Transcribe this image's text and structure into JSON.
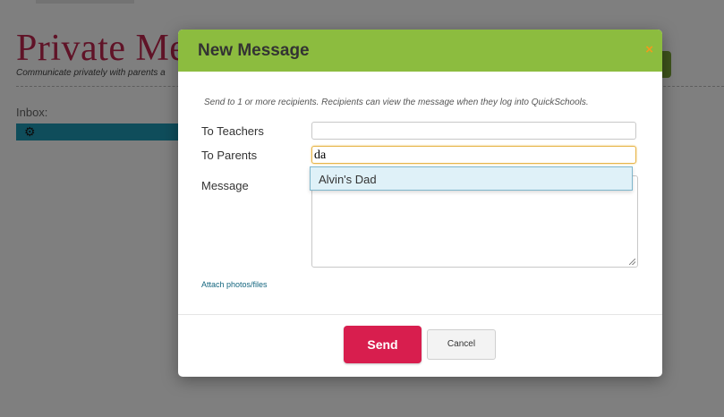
{
  "background": {
    "page_title": "Private Me",
    "subtitle": "Communicate privately with parents a",
    "inbox_label": "Inbox:",
    "inbox_icon": "gear-icon"
  },
  "modal": {
    "title": "New Message",
    "close_icon": "close-icon",
    "close_glyph": "×",
    "intro": "Send to 1 or more recipients. Recipients can view the message when they log into QuickSchools.",
    "fields": {
      "teachers_label": "To Teachers",
      "teachers_value": "",
      "parents_label": "To Parents",
      "parents_value": "da",
      "message_label": "Message",
      "message_value": ""
    },
    "suggestion": "Alvin's Dad",
    "attach_link": "Attach photos/files",
    "send_label": "Send",
    "cancel_label": "Cancel"
  },
  "colors": {
    "header_green": "#8cbc3f",
    "send_red": "#d81e4e",
    "title_red": "#c0264e",
    "inbox_blue": "#1e9ab6",
    "close_orange": "#f29a1d"
  }
}
